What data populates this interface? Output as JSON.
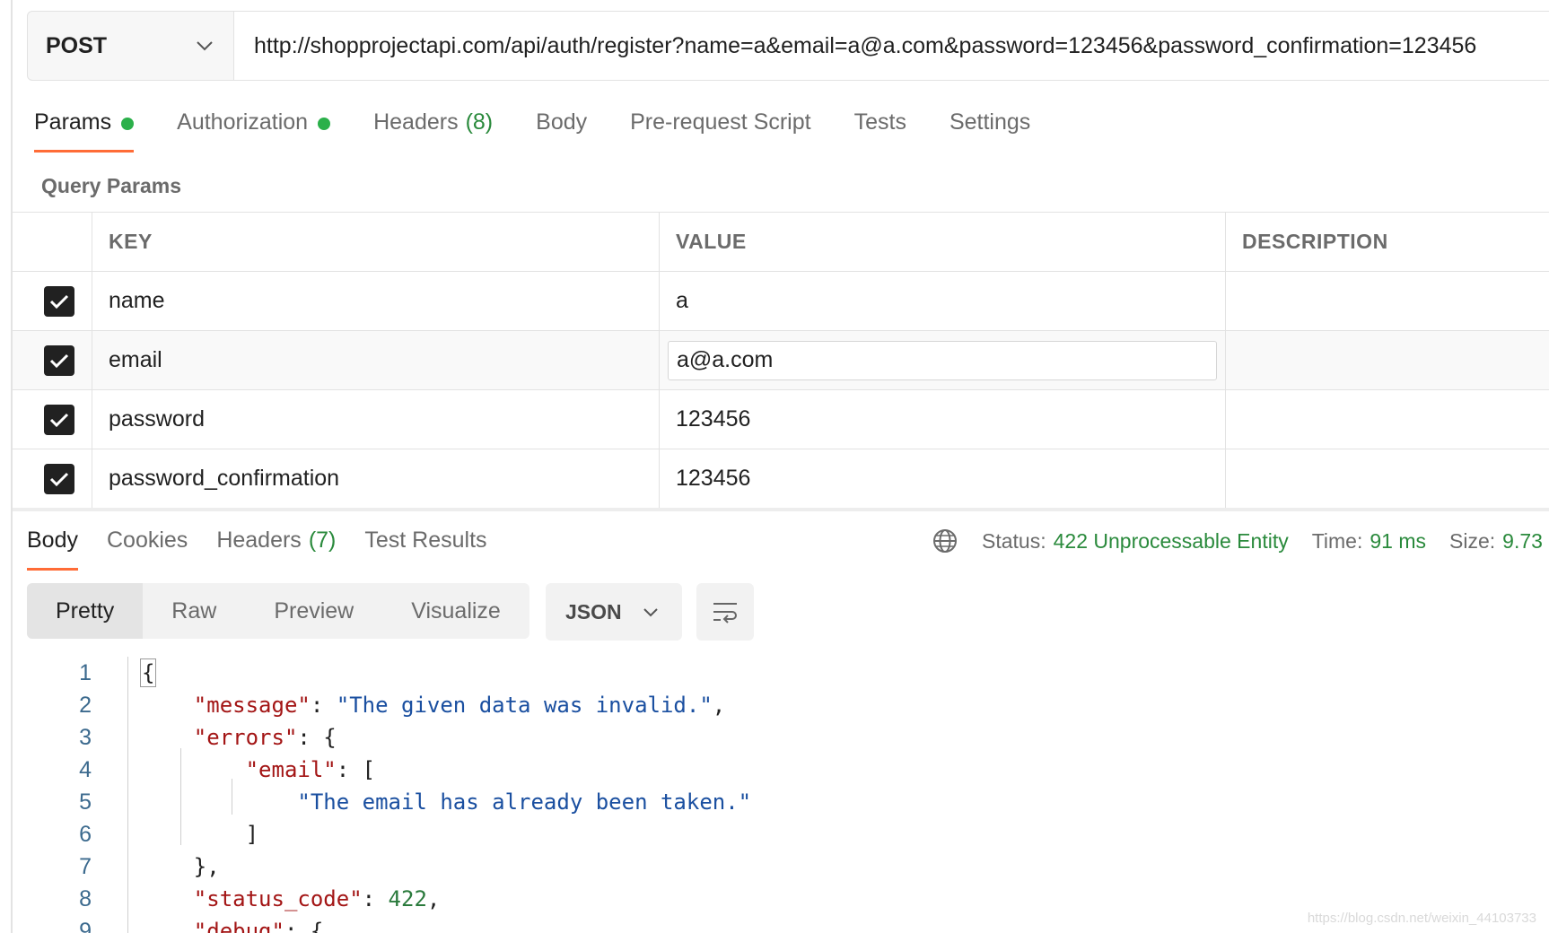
{
  "request": {
    "method": "POST",
    "url": "http://shopprojectapi.com/api/auth/register?name=a&email=a@a.com&password=123456&password_confirmation=123456"
  },
  "request_tabs": [
    {
      "label": "Params",
      "dot": true,
      "active": true
    },
    {
      "label": "Authorization",
      "dot": true
    },
    {
      "label": "Headers",
      "count": "(8)"
    },
    {
      "label": "Body"
    },
    {
      "label": "Pre-request Script"
    },
    {
      "label": "Tests"
    },
    {
      "label": "Settings"
    }
  ],
  "params": {
    "section_label": "Query Params",
    "columns": {
      "key": "KEY",
      "value": "VALUE",
      "description": "DESCRIPTION"
    },
    "rows": [
      {
        "key": "name",
        "value": "a",
        "checked": true
      },
      {
        "key": "email",
        "value": "a@a.com",
        "checked": true
      },
      {
        "key": "password",
        "value": "123456",
        "checked": true
      },
      {
        "key": "password_confirmation",
        "value": "123456",
        "checked": true
      }
    ]
  },
  "response_tabs": [
    {
      "label": "Body",
      "active": true
    },
    {
      "label": "Cookies"
    },
    {
      "label": "Headers",
      "count": "(7)"
    },
    {
      "label": "Test Results"
    }
  ],
  "status": {
    "status_label": "Status:",
    "status_value": "422 Unprocessable Entity",
    "time_label": "Time:",
    "time_value": "91 ms",
    "size_label": "Size:",
    "size_value": "9.73"
  },
  "format_buttons": [
    "Pretty",
    "Raw",
    "Preview",
    "Visualize"
  ],
  "language": "JSON",
  "code": {
    "line_numbers": [
      "1",
      "2",
      "3",
      "4",
      "5",
      "6",
      "7",
      "8",
      "9"
    ],
    "message_key": "\"message\"",
    "message_value": "\"The given data was invalid.\"",
    "errors_key": "\"errors\"",
    "email_key": "\"email\"",
    "email_error": "\"The email has already been taken.\"",
    "status_code_key": "\"status_code\"",
    "status_code_value": "422",
    "debug_key": "\"debug\""
  },
  "watermark": "https://blog.csdn.net/weixin_44103733",
  "colors": {
    "accent": "#ff6c37",
    "success": "#2bb04a"
  }
}
